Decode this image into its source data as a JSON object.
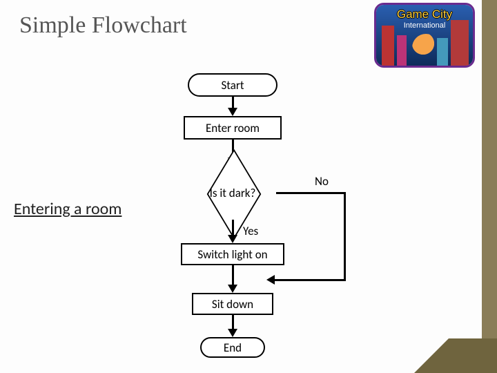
{
  "title": "Simple Flowchart",
  "subtitle": "Entering a room",
  "logo": {
    "title": "Game City",
    "subtitle": "International"
  },
  "nodes": {
    "start": "Start",
    "enter": "Enter room",
    "decision": "Is it dark?",
    "switch": "Switch light on",
    "sit": "Sit down",
    "end": "End"
  },
  "labels": {
    "yes": "Yes",
    "no": "No"
  },
  "chart_data": {
    "type": "flowchart",
    "nodes": [
      {
        "id": "start",
        "kind": "terminator",
        "text": "Start"
      },
      {
        "id": "enter",
        "kind": "process",
        "text": "Enter room"
      },
      {
        "id": "dark",
        "kind": "decision",
        "text": "Is it dark?"
      },
      {
        "id": "switch",
        "kind": "process",
        "text": "Switch light on"
      },
      {
        "id": "sit",
        "kind": "process",
        "text": "Sit down"
      },
      {
        "id": "end",
        "kind": "terminator",
        "text": "End"
      }
    ],
    "edges": [
      {
        "from": "start",
        "to": "enter"
      },
      {
        "from": "enter",
        "to": "dark"
      },
      {
        "from": "dark",
        "to": "switch",
        "label": "Yes"
      },
      {
        "from": "dark",
        "to": "sit",
        "label": "No",
        "via": "right-bypass"
      },
      {
        "from": "switch",
        "to": "sit"
      },
      {
        "from": "sit",
        "to": "end"
      }
    ]
  }
}
